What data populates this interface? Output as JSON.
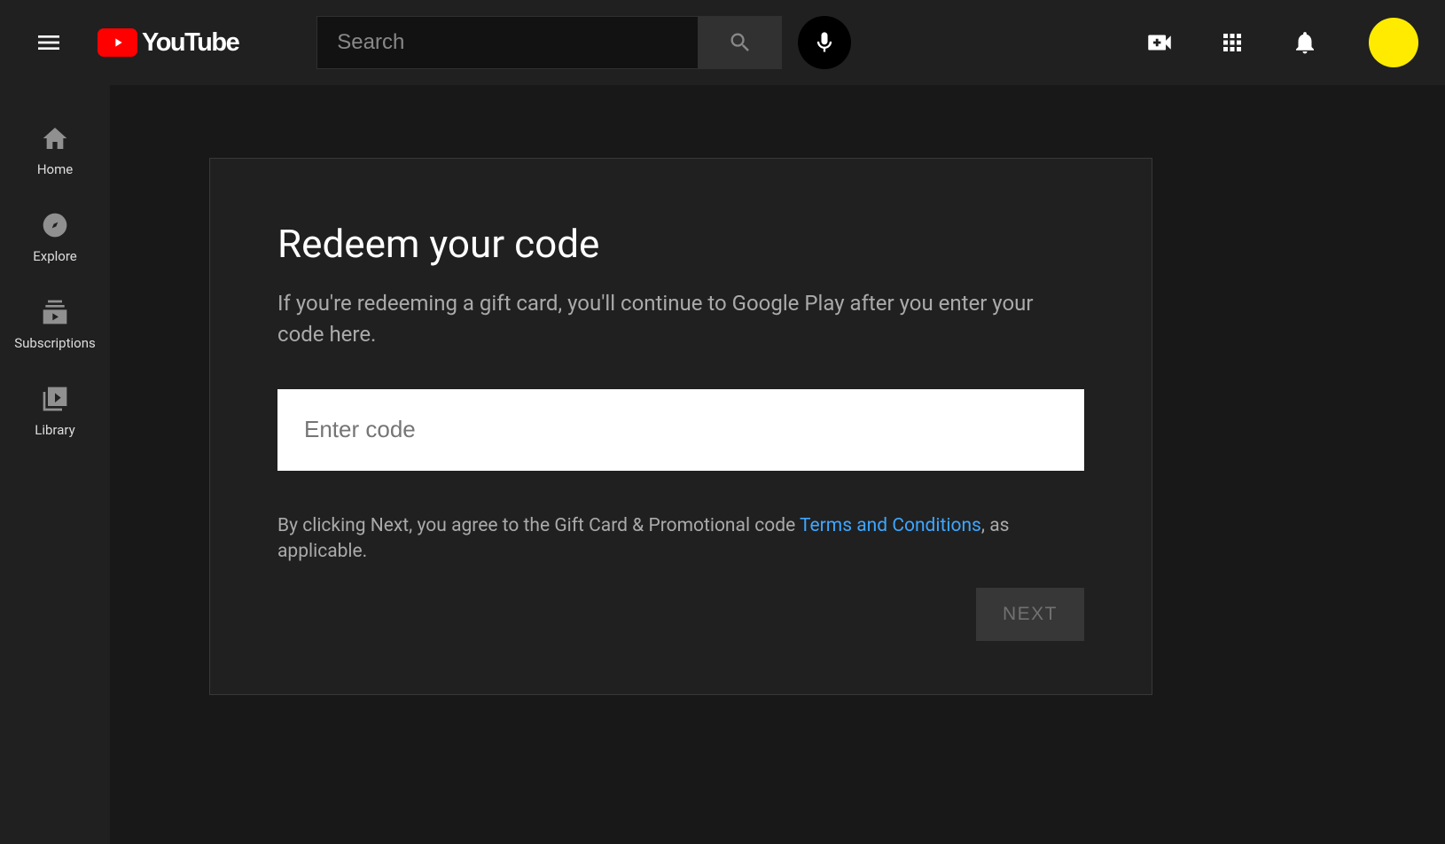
{
  "header": {
    "logo_text": "YouTube",
    "search_placeholder": "Search"
  },
  "sidebar": {
    "items": [
      {
        "label": "Home"
      },
      {
        "label": "Explore"
      },
      {
        "label": "Subscriptions"
      },
      {
        "label": "Library"
      }
    ]
  },
  "redeem": {
    "title": "Redeem your code",
    "description": "If you're redeeming a gift card, you'll continue to Google Play after you enter your code here.",
    "input_placeholder": "Enter code",
    "terms_pre": "By clicking Next, you agree to the Gift Card & Promotional code ",
    "terms_link": "Terms and Conditions",
    "terms_post": ", as applicable.",
    "next_label": "NEXT"
  }
}
